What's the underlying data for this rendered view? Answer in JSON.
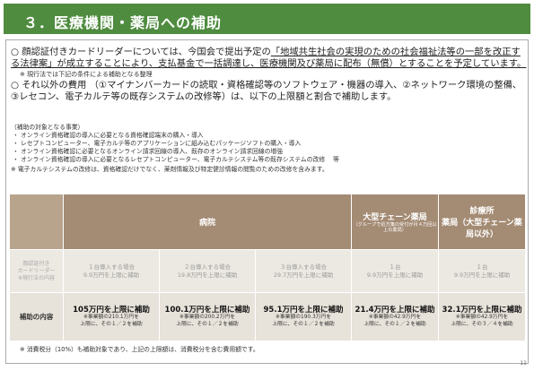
{
  "title": "３．医療機関・薬局への補助",
  "para1": {
    "circle": "○",
    "lead": "顔認証付きカードリーダーについては、今国会で提出予定の",
    "underlined": "「地域共生社会の実現のための社会福祉法等の一部を改正する法律案」が成立することにより、支払基金で一括調達し、医療機関及び薬局に配布（無償）とすることを予定しています。",
    "note": "※ 現行法では下記の条件による補助となる整理"
  },
  "para2": "○ それ以外の費用 （①マイナンバーカードの読取・資格確認等のソフトウェア・機器の導入、②ネットワーク環境の整備、③レセコン、電子カルテ等の既存システムの改修等）は、以下の上限額と割合で補助します。",
  "list": {
    "head": "（補助の対象となる事業）",
    "items": [
      "・ オンライン資格確認の導入に必要となる資格確認端末の購入・導入",
      "・ レセプトコンピューター、電子カルテ等のアプリケーションに組み込むパッケージソフトの購入・導入",
      "・ オンライン資格確認に必要となるオンライン請求回線の導入、既存のオンライン請求回線の増強",
      "・ オンライン資格確認の導入に必要となるレセプトコンピューター、電子カルテシステム等の既存システムの改修　 等"
    ],
    "note": "※ 電子カルテシステムの改修は、資格確認だけでなく、薬剤情報及び特定健診情報の閲覧のための改修を含みます。"
  },
  "table": {
    "headers": {
      "hospital": "病院",
      "chain_pharmacy": "大型チェーン薬局",
      "chain_pharmacy_sub": "（グループで処方箋の受付が月４万回以上の薬局）",
      "clinic": "診療所",
      "clinic_sub": "薬局（大型チェーン薬局以外）"
    },
    "row2_label": [
      "顔認証付き",
      "カードリーダー",
      "※現行法の内容"
    ],
    "row2": [
      [
        "１台導入する場合",
        "9.9万円を上限に補助"
      ],
      [
        "２台導入する場合",
        "19.8万円を上限に補助"
      ],
      [
        "３台導入する場合",
        "29.7万円を上限に補助"
      ],
      [
        "１台",
        "9.9万円を上限に補助"
      ],
      [
        "１台",
        "9.9万円を上限に補助"
      ]
    ],
    "row3_label": "補助の内容",
    "row3": [
      {
        "amount": "105万円を上限に補助",
        "note": [
          "※事業額の210.1万円を",
          "上限に、その１／２を補助"
        ]
      },
      {
        "amount": "100.1万円を上限に補助",
        "note": [
          "※事業額の200.2万円を",
          "上限に、その１／２を補助"
        ]
      },
      {
        "amount": "95.1万円を上限に補助",
        "note": [
          "※事業額の190.3万円を",
          "上限に、その１／２を補助"
        ]
      },
      {
        "amount": "21.4万円を上限に補助",
        "note": [
          "※事業額の42.9万円を",
          "上限に、その１／２を補助"
        ]
      },
      {
        "amount": "32.1万円を上限に補助",
        "note": [
          "※事業額の42.9万円を",
          "上限に、その３／４を補助"
        ]
      }
    ]
  },
  "footer": "※ 消費税分（10%）も補助対象であり、上記の上限額は、消費税分を含む費用額です。",
  "page_number": "11",
  "colors": {
    "title_bg": "#4f8c3f",
    "header_bg": "#a48b74",
    "row_bg": "#e7e2da"
  }
}
